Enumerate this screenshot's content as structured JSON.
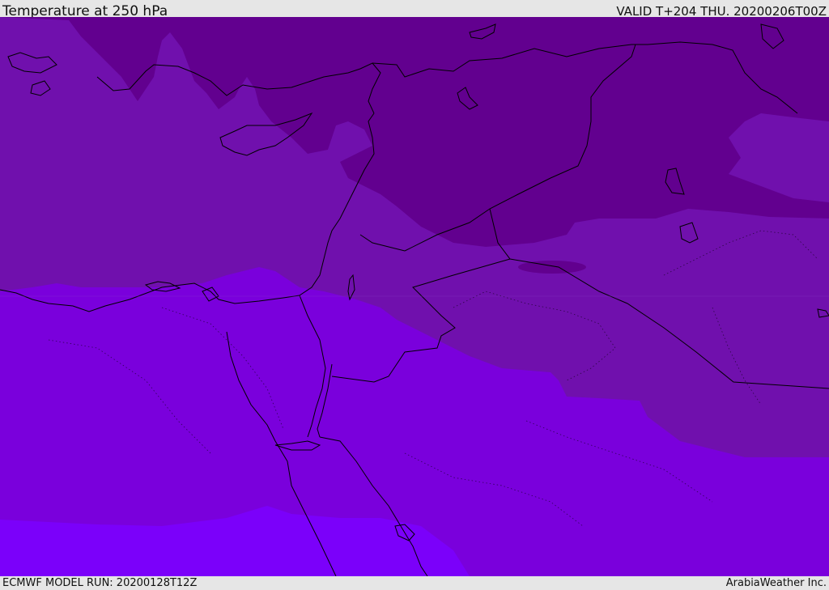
{
  "header": {
    "title": "Temperature at 250 hPa",
    "valid_time": "VALID T+204 THU. 20200206T00Z"
  },
  "footer": {
    "model_run": "ECMWF MODEL RUN: 20200128T12Z",
    "credit": "ArabiaWeather Inc."
  },
  "map": {
    "colors": {
      "coldest_band": "#62008f",
      "cold_band": "#7010ad",
      "mid_band": "#7a00dc",
      "warm_band": "#7b00fa",
      "coastline": "#000000"
    },
    "icons": [
      "coastline-outline",
      "border-lines",
      "temperature-contours"
    ]
  }
}
